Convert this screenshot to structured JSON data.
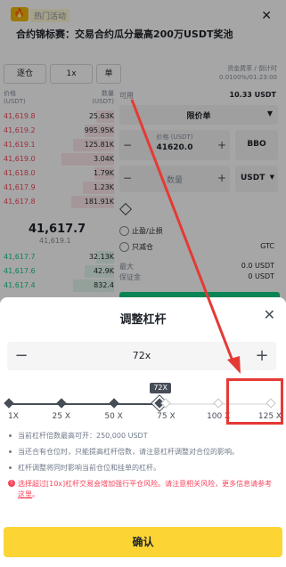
{
  "banner": {
    "tag_label": "热门活动",
    "headline": "合约锦标赛：交易合约瓜分最高200万USDT奖池",
    "close_icon": "close-icon"
  },
  "trade": {
    "modes": [
      "逐仓",
      "1x",
      "单"
    ],
    "funding_label": "资金费率 / 倒计时",
    "funding_value": "0.0100%/01:23:00",
    "orderbook_header_left": "价格\n(USDT)",
    "orderbook_header_right": "数量\n(USDT)",
    "asks": [
      {
        "price": "41,619.8",
        "qty": "25.63K"
      },
      {
        "price": "41,619.2",
        "qty": "995.95K"
      },
      {
        "price": "41,619.1",
        "qty": "125.81K"
      },
      {
        "price": "41,619.0",
        "qty": "3.04K"
      },
      {
        "price": "41,618.0",
        "qty": "1.79K"
      },
      {
        "price": "41,617.9",
        "qty": "1.23K"
      },
      {
        "price": "41,617.8",
        "qty": "181.91K"
      }
    ],
    "mid_price": "41,617.7",
    "mid_sub": "41,619.1",
    "bids": [
      {
        "price": "41,617.7",
        "qty": "32.13K"
      },
      {
        "price": "41,617.6",
        "qty": "42.9K"
      },
      {
        "price": "41,617.4",
        "qty": "832.4"
      }
    ],
    "available_label": "可用",
    "available_value": "10.33 USDT",
    "order_type": "限价单",
    "price_label": "价格 (USDT)",
    "price_value": "41620.0",
    "bbo_label": "BBO",
    "qty_label": "数量",
    "qty_unit": "USDT",
    "tpsl_label": "止盈/止损",
    "reduce_only_label": "只减仓",
    "tif_label": "GTC",
    "max_label": "最大",
    "max_value": "0.0 USDT",
    "margin_label": "保证金",
    "margin_value": "0 USDT"
  },
  "sheet": {
    "title": "调整杠杆",
    "minus_label": "−",
    "plus_label": "+",
    "leverage_value": "72x",
    "tooltip": "72X",
    "ticks": [
      "1X",
      "25 X",
      "50 X",
      "75 X",
      "100 X",
      "125 X"
    ],
    "selected_fraction": 0.576,
    "notes": [
      "当前杠杆倍数最高可开：250,000 USDT",
      "当还合有仓位时，只能提高杠杆倍数，请注意杠杆调整对合位的影响。",
      "杠杆调整将同时影响当前仓位和挂单的杠杆。"
    ],
    "warning_prefix": "选择超过[10x]杠杆交易会增加强行平仓风险。请注意相关风险，更多信息请参考",
    "warning_link": "这里",
    "warning_suffix": "。",
    "confirm_label": "确认"
  },
  "colors": {
    "accent_yellow": "#fcd535",
    "ask_red": "#f6465d",
    "bid_green": "#0ecb81",
    "annotation_red": "#e53935"
  }
}
